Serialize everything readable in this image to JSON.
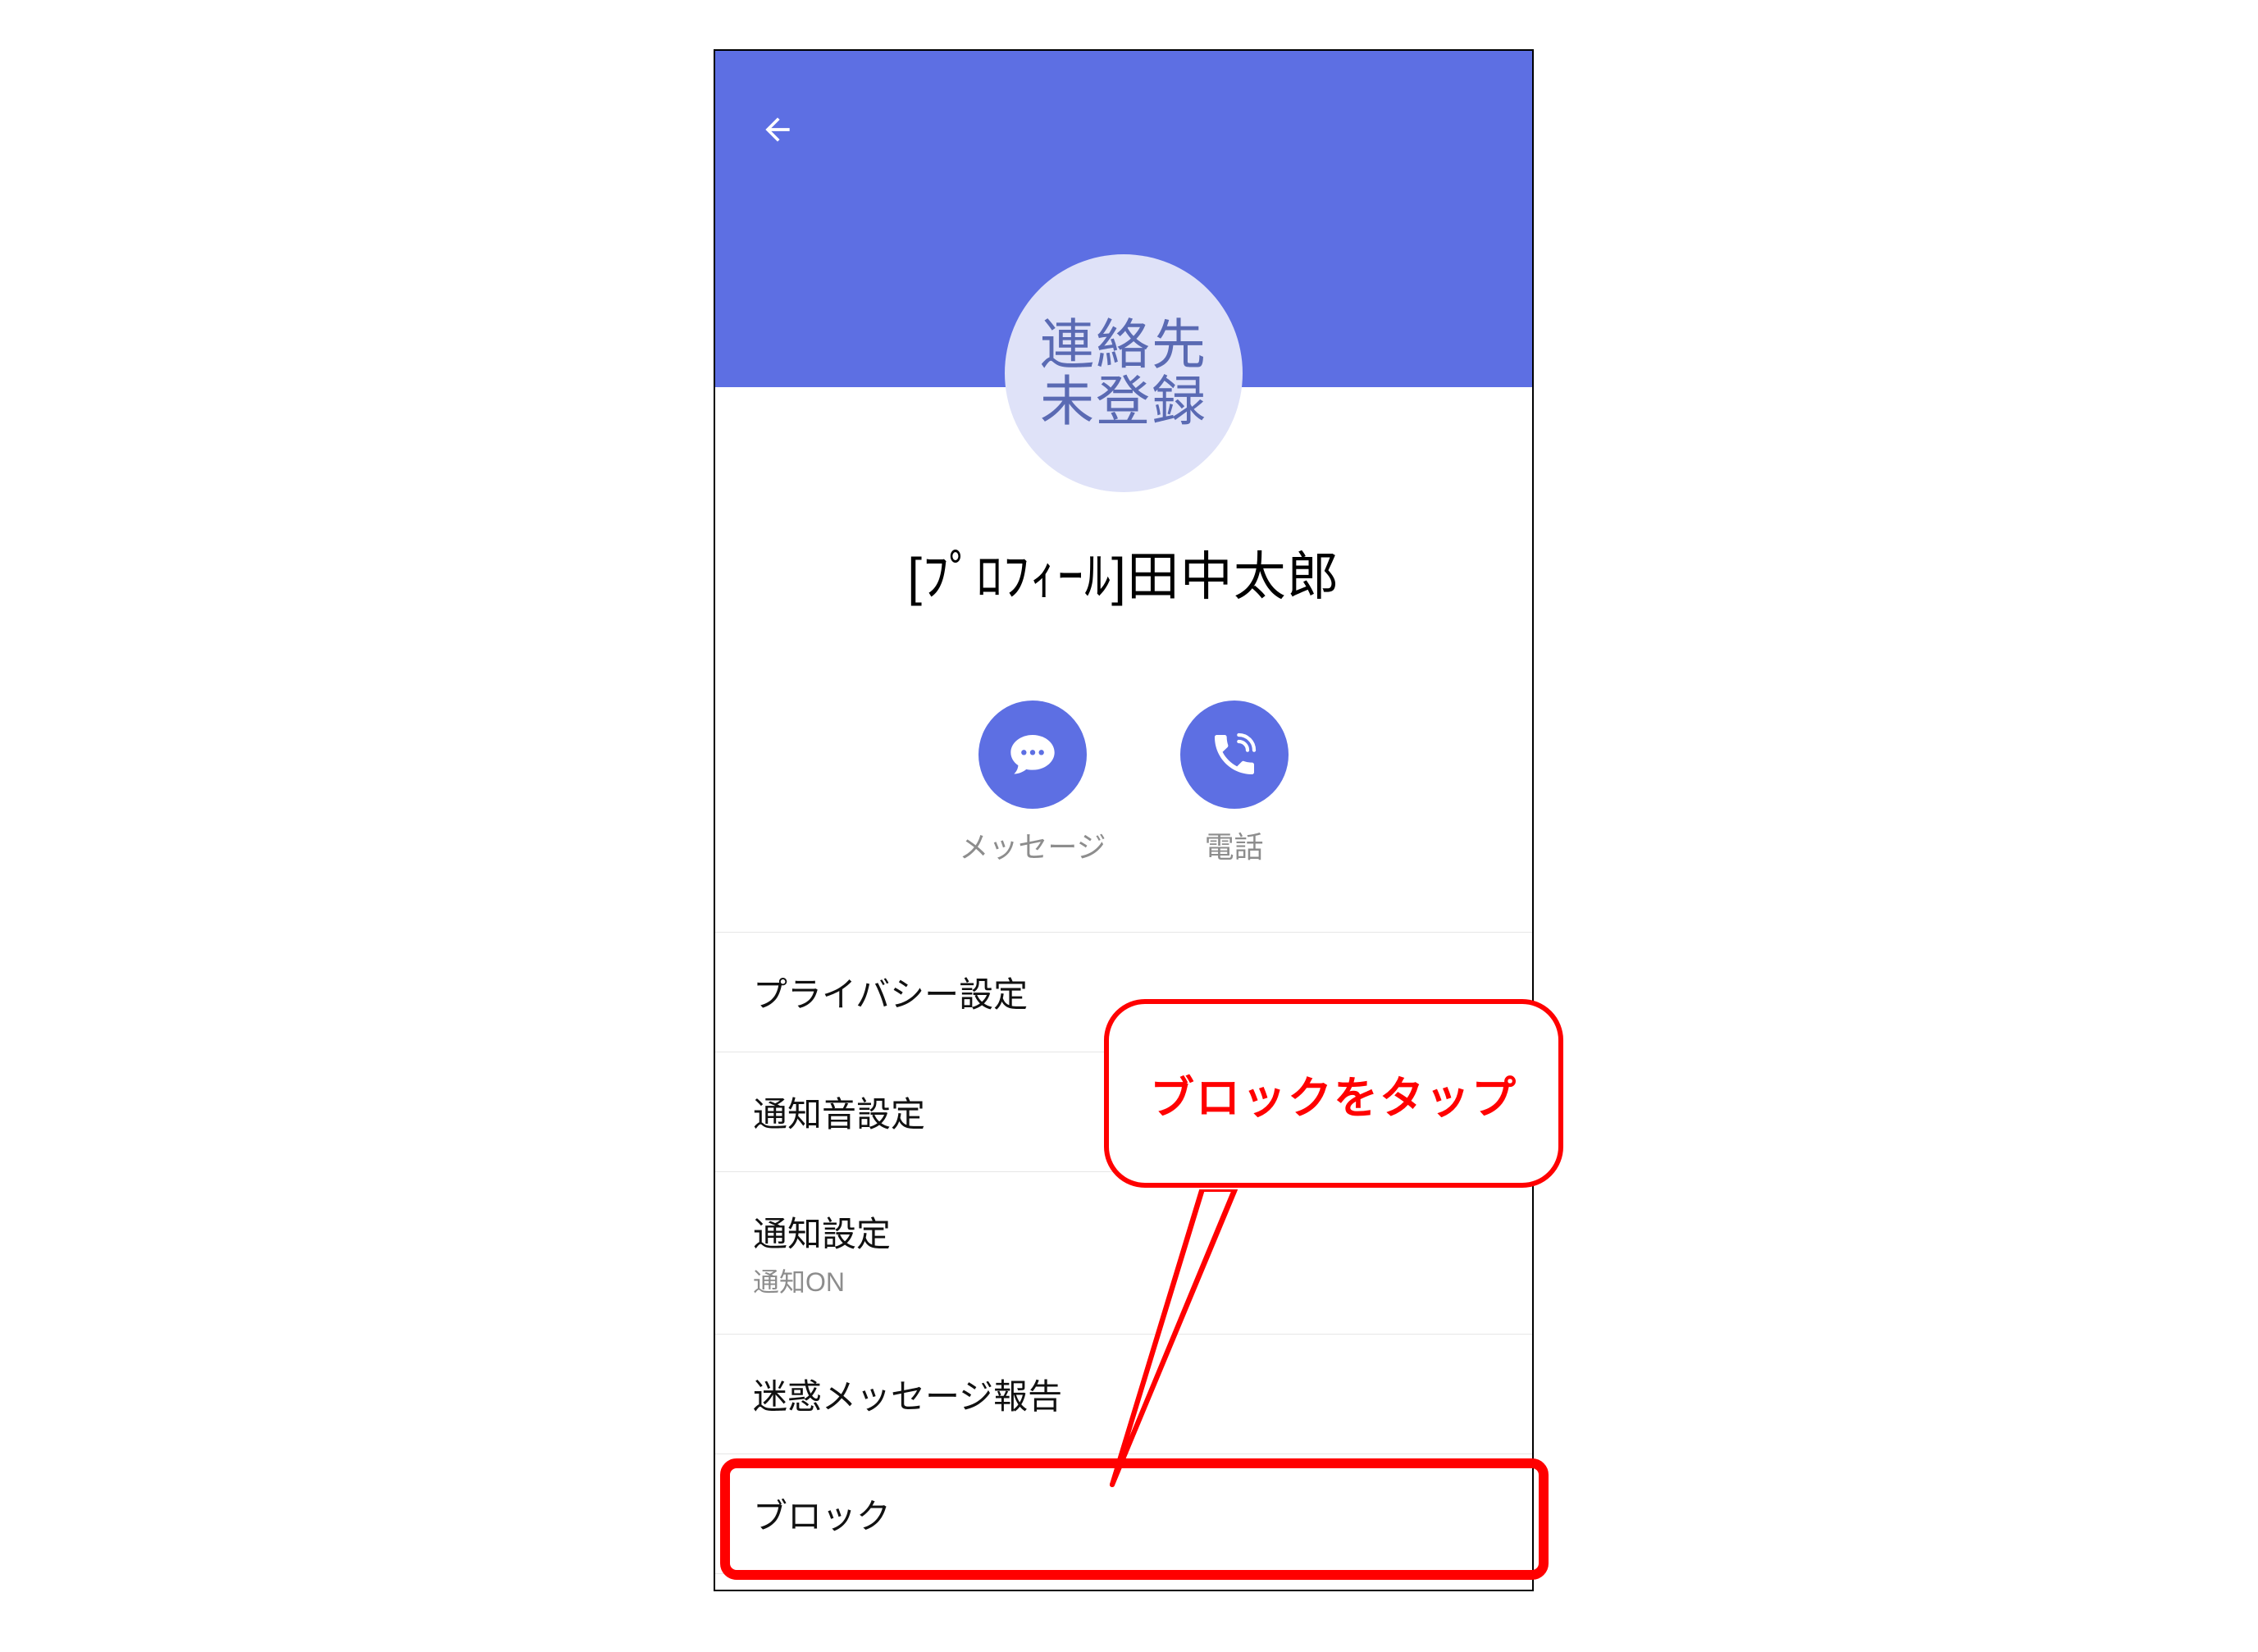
{
  "header": {
    "back_icon": "arrow-back"
  },
  "avatar": {
    "line1": "連絡先",
    "line2": "未登録"
  },
  "profile": {
    "name": "[ﾌﾟﾛﾌｨｰﾙ]田中太郎"
  },
  "actions": {
    "message": {
      "label": "メッセージ",
      "icon": "chat"
    },
    "call": {
      "label": "電話",
      "icon": "phone"
    }
  },
  "settings": [
    {
      "title": "プライバシー設定",
      "sub": ""
    },
    {
      "title": "通知音設定",
      "sub": ""
    },
    {
      "title": "通知設定",
      "sub": "通知ON"
    },
    {
      "title": "迷惑メッセージ報告",
      "sub": ""
    },
    {
      "title": "ブロック",
      "sub": ""
    }
  ],
  "annotation": {
    "callout": "ブロックをタップ"
  },
  "colors": {
    "primary": "#5d6fe3",
    "annotation": "#ff0000"
  }
}
